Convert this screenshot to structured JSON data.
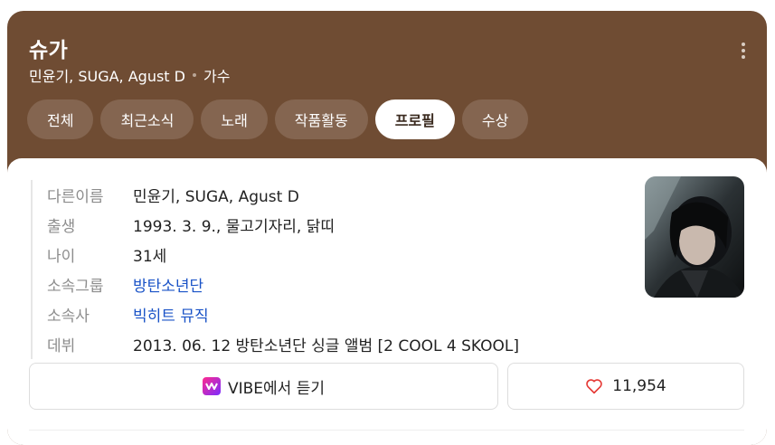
{
  "header": {
    "name": "슈가",
    "aliases": "민윤기, SUGA, Agust D",
    "occupation": "가수"
  },
  "tabs": [
    {
      "label": "전체",
      "active": false
    },
    {
      "label": "최근소식",
      "active": false
    },
    {
      "label": "노래",
      "active": false
    },
    {
      "label": "작품활동",
      "active": false
    },
    {
      "label": "프로필",
      "active": true
    },
    {
      "label": "수상",
      "active": false
    }
  ],
  "profile": {
    "rows": [
      {
        "label": "다른이름",
        "value": "민윤기, SUGA, Agust D",
        "link": false
      },
      {
        "label": "출생",
        "value": "1993. 3. 9., 물고기자리, 닭띠",
        "link": false
      },
      {
        "label": "나이",
        "value": "31세",
        "link": false
      },
      {
        "label": "소속그룹",
        "value": "방탄소년단",
        "link": true
      },
      {
        "label": "소속사",
        "value": "빅히트 뮤직",
        "link": true
      },
      {
        "label": "데뷔",
        "value": "2013. 06. 12 방탄소년단 싱글 앨범 [2 COOL 4 SKOOL]",
        "link": false
      }
    ]
  },
  "actions": {
    "vibe_label": "VIBE에서 듣기",
    "like_count": "11,954"
  },
  "colors": {
    "header_bg": "#6f4c33",
    "tab_bg": "#846550",
    "link": "#1a53c7",
    "heart": "#e53935",
    "vibe_gradient_start": "#ff2a8e",
    "vibe_gradient_end": "#7a2cff"
  },
  "icons": {
    "more": "more-vertical-icon",
    "vibe": "vibe-logo-icon",
    "like": "heart-outline-icon"
  }
}
